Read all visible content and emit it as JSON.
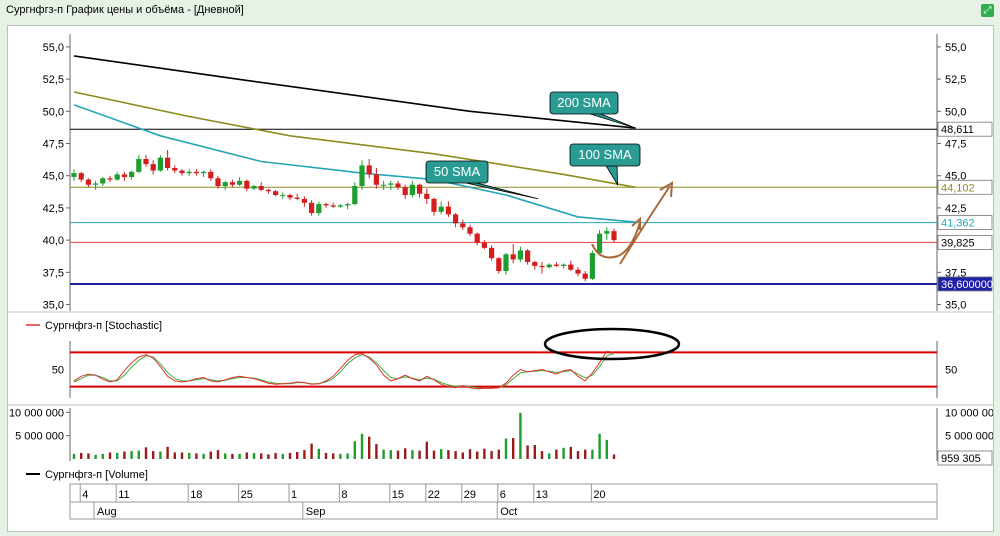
{
  "window": {
    "title": "Сургнфгз-п График цены и объёма - [Дневной]"
  },
  "colors": {
    "up": "#1e9e2e",
    "down": "#d41e1e",
    "sma200": "#000000",
    "sma100": "#8d8b1e",
    "sma50": "#25a6b6",
    "support": "#2020a0",
    "level_red": "#e84646",
    "callout": "#2a9b93",
    "arrow": "#a8683a",
    "stoch_main": "#e03030",
    "stoch_signal": "#3cb13c",
    "stoch_band": "#d80000"
  },
  "chart_data": [
    {
      "type": "candlestick",
      "title": "",
      "y_ticks": [
        "55,0",
        "52,5",
        "50,0",
        "47,5",
        "45,0",
        "42,5",
        "40,0",
        "37,5",
        "35,0"
      ],
      "ylim": [
        34.5,
        56.0
      ],
      "x_labels": {
        "days": [
          "4",
          "11",
          "18",
          "25",
          "1",
          "8",
          "15",
          "22",
          "29",
          "6",
          "13",
          "20"
        ],
        "months": [
          "Aug",
          "Sep",
          "Oct"
        ]
      },
      "candles": [
        [
          44.9,
          45.5,
          44.6,
          45.2
        ],
        [
          45.2,
          45.3,
          44.5,
          44.7
        ],
        [
          44.7,
          44.8,
          44.1,
          44.3
        ],
        [
          44.3,
          44.6,
          43.9,
          44.4
        ],
        [
          44.4,
          44.9,
          44.2,
          44.8
        ],
        [
          44.8,
          45.0,
          44.5,
          44.7
        ],
        [
          44.7,
          45.3,
          44.6,
          45.1
        ],
        [
          45.1,
          45.3,
          44.6,
          44.9
        ],
        [
          44.9,
          45.4,
          44.7,
          45.3
        ],
        [
          45.3,
          46.6,
          45.2,
          46.3
        ],
        [
          46.3,
          46.6,
          45.7,
          45.9
        ],
        [
          45.9,
          46.2,
          45.1,
          45.4
        ],
        [
          45.4,
          46.6,
          45.3,
          46.4
        ],
        [
          46.4,
          47.0,
          45.4,
          45.6
        ],
        [
          45.6,
          45.8,
          45.2,
          45.4
        ],
        [
          45.4,
          45.5,
          45.0,
          45.2
        ],
        [
          45.2,
          45.5,
          45.0,
          45.3
        ],
        [
          45.3,
          45.5,
          45.0,
          45.2
        ],
        [
          45.2,
          45.4,
          44.9,
          45.3
        ],
        [
          45.3,
          45.5,
          44.6,
          44.8
        ],
        [
          44.8,
          45.0,
          44.0,
          44.2
        ],
        [
          44.2,
          44.6,
          43.9,
          44.5
        ],
        [
          44.5,
          44.7,
          44.1,
          44.3
        ],
        [
          44.3,
          44.9,
          44.2,
          44.6
        ],
        [
          44.6,
          44.7,
          43.8,
          44.0
        ],
        [
          44.0,
          44.3,
          43.9,
          44.2
        ],
        [
          44.2,
          44.5,
          43.8,
          43.9
        ],
        [
          43.9,
          44.0,
          43.6,
          43.8
        ],
        [
          43.8,
          43.9,
          43.4,
          43.5
        ],
        [
          43.5,
          43.7,
          43.2,
          43.5
        ],
        [
          43.5,
          43.6,
          43.1,
          43.3
        ],
        [
          43.3,
          43.6,
          43.1,
          43.2
        ],
        [
          43.2,
          43.4,
          42.6,
          42.9
        ],
        [
          42.9,
          43.1,
          41.9,
          42.1
        ],
        [
          42.1,
          43.0,
          41.9,
          42.8
        ],
        [
          42.8,
          42.9,
          42.5,
          42.7
        ],
        [
          42.7,
          42.9,
          42.5,
          42.6
        ],
        [
          42.6,
          42.8,
          42.5,
          42.7
        ],
        [
          42.7,
          42.9,
          42.4,
          42.8
        ],
        [
          42.8,
          44.5,
          42.7,
          44.2
        ],
        [
          44.2,
          46.2,
          43.9,
          45.8
        ],
        [
          45.8,
          46.3,
          44.8,
          45.1
        ],
        [
          45.1,
          45.6,
          44.0,
          44.3
        ],
        [
          44.3,
          44.6,
          43.9,
          44.3
        ],
        [
          44.3,
          44.6,
          43.9,
          44.4
        ],
        [
          44.4,
          44.6,
          43.9,
          44.1
        ],
        [
          44.1,
          44.3,
          43.2,
          43.5
        ],
        [
          43.5,
          44.6,
          43.3,
          44.3
        ],
        [
          44.3,
          44.4,
          43.3,
          43.6
        ],
        [
          43.6,
          44.0,
          42.8,
          43.2
        ],
        [
          43.2,
          43.3,
          41.9,
          42.2
        ],
        [
          42.2,
          43.0,
          42.0,
          42.6
        ],
        [
          42.6,
          43.0,
          41.8,
          42.0
        ],
        [
          42.0,
          42.1,
          41.0,
          41.3
        ],
        [
          41.3,
          41.6,
          40.8,
          41.0
        ],
        [
          41.0,
          41.2,
          40.3,
          40.5
        ],
        [
          40.5,
          40.6,
          39.6,
          39.8
        ],
        [
          39.8,
          40.0,
          39.3,
          39.4
        ],
        [
          39.4,
          39.6,
          38.4,
          38.6
        ],
        [
          38.6,
          38.7,
          37.4,
          37.6
        ],
        [
          37.6,
          39.0,
          37.3,
          38.9
        ],
        [
          38.9,
          39.7,
          38.2,
          38.5
        ],
        [
          38.5,
          39.5,
          38.3,
          39.2
        ],
        [
          39.2,
          39.3,
          38.1,
          38.3
        ],
        [
          38.3,
          38.4,
          37.7,
          38.0
        ],
        [
          38.0,
          38.3,
          37.4,
          37.9
        ],
        [
          37.9,
          38.2,
          37.8,
          38.1
        ],
        [
          38.1,
          38.3,
          37.9,
          38.0
        ],
        [
          38.0,
          38.2,
          37.8,
          38.1
        ],
        [
          38.1,
          38.4,
          37.6,
          37.7
        ],
        [
          37.7,
          37.9,
          37.2,
          37.4
        ],
        [
          37.4,
          37.6,
          36.8,
          37.0
        ],
        [
          37.0,
          39.2,
          36.9,
          39.0
        ],
        [
          39.0,
          40.8,
          38.8,
          40.5
        ],
        [
          40.5,
          41.0,
          40.0,
          40.7
        ],
        [
          40.7,
          40.9,
          39.8,
          40.0
        ]
      ],
      "sma200": [
        [
          0,
          54.3
        ],
        [
          24,
          52.4
        ],
        [
          55,
          50.0
        ],
        [
          78,
          48.7
        ]
      ],
      "sma100": [
        [
          0,
          51.5
        ],
        [
          16,
          49.6
        ],
        [
          30,
          48.1
        ],
        [
          50,
          46.7
        ],
        [
          68,
          45.1
        ],
        [
          78,
          44.1
        ]
      ],
      "sma50": [
        [
          0,
          50.5
        ],
        [
          12,
          48.1
        ],
        [
          26,
          46.1
        ],
        [
          40,
          45.2
        ],
        [
          50,
          44.7
        ],
        [
          60,
          43.5
        ],
        [
          70,
          41.8
        ],
        [
          78,
          41.4
        ]
      ],
      "levels": [
        {
          "value": 48.611,
          "label": "48,611",
          "color_key": "sma200"
        },
        {
          "value": 44.102,
          "label": "44,102",
          "color_key": "sma100"
        },
        {
          "value": 41.362,
          "label": "41,362",
          "color_key": "sma50"
        },
        {
          "value": 39.825,
          "label": "39,825",
          "color_key": "level_red"
        },
        {
          "value": 36.6,
          "label": "36,600000",
          "color_key": "support"
        }
      ],
      "annotations": [
        {
          "label": "200 SMA",
          "target": [
            78.0,
            48.7
          ]
        },
        {
          "label": "100 SMA",
          "target": [
            75.5,
            44.3
          ]
        },
        {
          "label": "50 SMA",
          "target": [
            64.5,
            43.2
          ]
        }
      ]
    },
    {
      "type": "line",
      "legend": "Сургнфгз-п [Stochastic]",
      "y_ticks": [
        "50"
      ],
      "ylim": [
        0,
        100
      ],
      "bands": [
        80,
        20
      ],
      "series": [
        {
          "name": "main",
          "values": [
            30,
            38,
            42,
            40,
            33,
            28,
            32,
            48,
            62,
            72,
            76,
            70,
            55,
            38,
            30,
            28,
            30,
            34,
            36,
            30,
            28,
            32,
            36,
            38,
            36,
            34,
            30,
            26,
            24,
            25,
            26,
            28,
            27,
            24,
            25,
            30,
            38,
            52,
            66,
            76,
            78,
            70,
            58,
            40,
            30,
            34,
            40,
            34,
            30,
            38,
            32,
            24,
            20,
            18,
            22,
            18,
            16,
            17,
            17,
            18,
            26,
            40,
            50,
            46,
            48,
            50,
            46,
            42,
            48,
            50,
            38,
            30,
            44,
            62,
            82,
            80
          ]
        },
        {
          "name": "signal",
          "values": [
            28,
            34,
            40,
            40,
            36,
            30,
            30,
            40,
            54,
            66,
            74,
            72,
            60,
            45,
            34,
            30,
            30,
            32,
            34,
            32,
            30,
            31,
            34,
            36,
            36,
            35,
            32,
            28,
            26,
            25,
            25,
            27,
            27,
            25,
            25,
            28,
            34,
            46,
            60,
            70,
            76,
            72,
            62,
            48,
            36,
            34,
            37,
            35,
            32,
            35,
            33,
            27,
            23,
            20,
            21,
            20,
            18,
            17,
            17,
            18,
            23,
            34,
            44,
            46,
            47,
            48,
            47,
            45,
            46,
            48,
            42,
            35,
            40,
            55,
            74,
            78
          ]
        }
      ]
    },
    {
      "type": "bar",
      "legend": "Сургнфгз-п [Volume]",
      "y_ticks": [
        "10 000 000",
        "5 000 000"
      ],
      "ylim": [
        0,
        10500000
      ],
      "last_label": "959 305",
      "values": [
        1100000,
        1300000,
        1200000,
        900000,
        1100000,
        1400000,
        1300000,
        1600000,
        1700000,
        1800000,
        2500000,
        1700000,
        1600000,
        2600000,
        1400000,
        1400000,
        1300000,
        1200000,
        1100000,
        1600000,
        1900000,
        1200000,
        1100000,
        1100000,
        1400000,
        1300000,
        1200000,
        1000000,
        1300000,
        1100000,
        1300000,
        1500000,
        1900000,
        3300000,
        2200000,
        1300000,
        1200000,
        1100000,
        1200000,
        3800000,
        5400000,
        4800000,
        3200000,
        2000000,
        1900000,
        1800000,
        2300000,
        1900000,
        1800000,
        3700000,
        1800000,
        2100000,
        1900000,
        1700000,
        1400000,
        2100000,
        1600000,
        2200000,
        1700000,
        2000000,
        4400000,
        4500000,
        9900000,
        2900000,
        3000000,
        1700000,
        1200000,
        2000000,
        2400000,
        2600000,
        1700000,
        2000000,
        2000000,
        5400000,
        4100000,
        959305
      ]
    }
  ]
}
